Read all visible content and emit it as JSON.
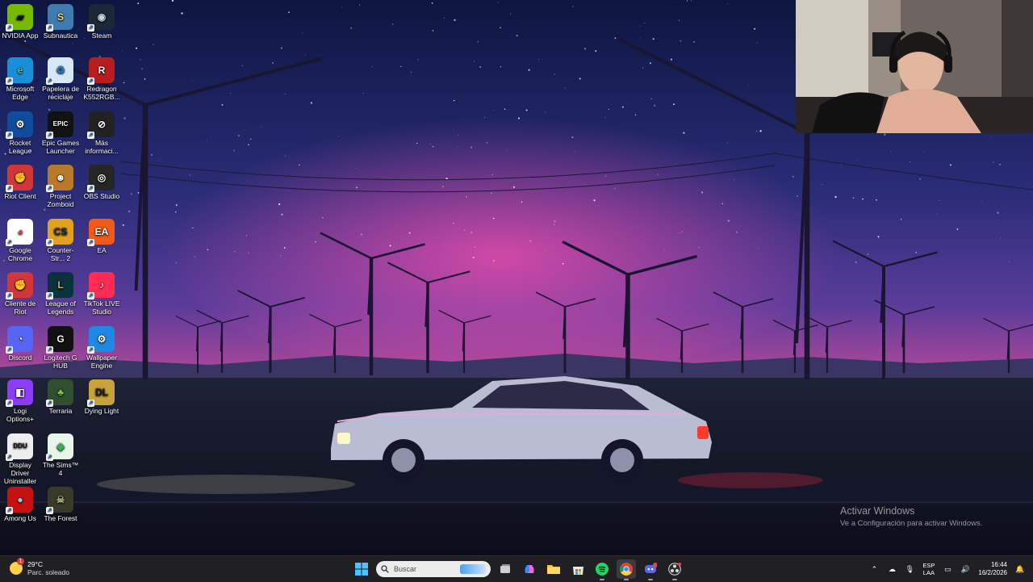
{
  "desktop": {
    "icons": [
      {
        "label": "NVIDIA App",
        "color": "#76b900",
        "fg": "#111",
        "glyph": "▰",
        "col": 0,
        "row": 0
      },
      {
        "label": "Subnautica",
        "color": "#3e7cb0",
        "fg": "#f3d27a",
        "glyph": "S",
        "col": 1,
        "row": 0
      },
      {
        "label": "Steam",
        "color": "#1b2838",
        "fg": "#c7d5e0",
        "glyph": "◉",
        "col": 2,
        "row": 0
      },
      {
        "label": "Microsoft Edge",
        "color": "#1a8fd8",
        "fg": "#3ccf8e",
        "glyph": "e",
        "col": 0,
        "row": 1
      },
      {
        "label": "Papelera de reciclaje",
        "color": "#d6e8f5",
        "fg": "#2a7ab8",
        "glyph": "♻",
        "col": 1,
        "row": 1
      },
      {
        "label": "Redragon K552RGB...",
        "color": "#b91c1c",
        "fg": "#fff",
        "glyph": "R",
        "col": 2,
        "row": 1
      },
      {
        "label": "Rocket League",
        "color": "#0f4c9c",
        "fg": "#fff",
        "glyph": "⚙",
        "col": 0,
        "row": 2
      },
      {
        "label": "Epic Games Launcher",
        "color": "#121212",
        "fg": "#fff",
        "glyph": "EPIC",
        "col": 1,
        "row": 2
      },
      {
        "label": "Más informaci...",
        "color": "#222",
        "fg": "#fff",
        "glyph": "⊘",
        "col": 2,
        "row": 2
      },
      {
        "label": "Riot Client",
        "color": "#d13639",
        "fg": "#fff",
        "glyph": "✊",
        "col": 0,
        "row": 3
      },
      {
        "label": "Project Zomboid",
        "color": "#b87a2a",
        "fg": "#fff",
        "glyph": "☻",
        "col": 1,
        "row": 3
      },
      {
        "label": "OBS Studio",
        "color": "#262626",
        "fg": "#fff",
        "glyph": "◎",
        "col": 2,
        "row": 3
      },
      {
        "label": "Google Chrome",
        "color": "#ffffff",
        "fg": "#db4437",
        "glyph": "◕",
        "col": 0,
        "row": 4
      },
      {
        "label": "Counter-Str... 2",
        "color": "#e0a020",
        "fg": "#1d2b3a",
        "glyph": "CS",
        "col": 1,
        "row": 4
      },
      {
        "label": "EA",
        "color": "#f05a1a",
        "fg": "#fff",
        "glyph": "EA",
        "col": 2,
        "row": 4
      },
      {
        "label": "Cliente de Riot",
        "color": "#d13639",
        "fg": "#fff",
        "glyph": "✊",
        "col": 0,
        "row": 5
      },
      {
        "label": "League of Legends",
        "color": "#0a323c",
        "fg": "#c8aa6e",
        "glyph": "L",
        "col": 1,
        "row": 5
      },
      {
        "label": "TikTok LIVE Studio",
        "color": "#fe2c55",
        "fg": "#fff",
        "glyph": "♪",
        "col": 2,
        "row": 5
      },
      {
        "label": "Discord",
        "color": "#5865f2",
        "fg": "#fff",
        "glyph": "◔",
        "col": 0,
        "row": 6
      },
      {
        "label": "Logitech G HUB",
        "color": "#111",
        "fg": "#fff",
        "glyph": "G",
        "col": 1,
        "row": 6
      },
      {
        "label": "Wallpaper Engine",
        "color": "#1e88e5",
        "fg": "#fff",
        "glyph": "⚙",
        "col": 2,
        "row": 6
      },
      {
        "label": "Logi Options+",
        "color": "#8b3cf7",
        "fg": "#fff",
        "glyph": "◧",
        "col": 0,
        "row": 7
      },
      {
        "label": "Terraria",
        "color": "#2f4f2f",
        "fg": "#7ccf4a",
        "glyph": "♣",
        "col": 1,
        "row": 7
      },
      {
        "label": "Dying Light",
        "color": "#c8a23a",
        "fg": "#1a1a1a",
        "glyph": "DL",
        "col": 2,
        "row": 7
      },
      {
        "label": "Display Driver Uninstaller",
        "color": "#eeeeee",
        "fg": "#111",
        "glyph": "DDU",
        "col": 0,
        "row": 8
      },
      {
        "label": "The Sims™ 4",
        "color": "#e8f5e9",
        "fg": "#31b34a",
        "glyph": "◆",
        "col": 1,
        "row": 8
      },
      {
        "label": "Among Us",
        "color": "#c51111",
        "fg": "#7fd3f2",
        "glyph": "●",
        "col": 0,
        "row": 9
      },
      {
        "label": "The Forest",
        "color": "#3a3a2a",
        "fg": "#a8b07a",
        "glyph": "☠",
        "col": 1,
        "row": 9
      }
    ]
  },
  "activation": {
    "title": "Activar Windows",
    "subtitle": "Ve a Configuración para activar Windows."
  },
  "taskbar": {
    "weather": {
      "temp": "29°C",
      "condition": "Parc. soleado",
      "badge": "1"
    },
    "search_placeholder": "Buscar",
    "tray": {
      "lang_top": "ESP",
      "lang_bottom": "LAA",
      "time": "16:44",
      "date": "16/2/2026"
    }
  }
}
